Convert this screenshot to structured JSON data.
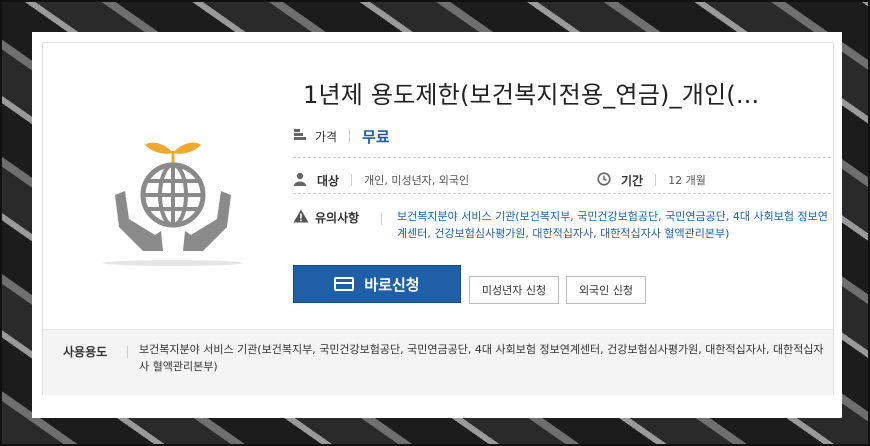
{
  "service": {
    "title": "1년제 용도제한(보건복지전용_연금)_개인(...",
    "price_label": "가격",
    "price_value": "무료",
    "target_label": "대상",
    "target_value": "개인, 미성년자, 외국인",
    "period_label": "기간",
    "period_value": "12 개월",
    "caution_label": "유의사항",
    "caution_text": "보건복지분야 서비스 기관(보건복지부, 국민건강보험공단, 국민연금공단, 4대 사회보험 정보연계센터, 건강보험심사평가원, 대한적십자사, 대한적십자사 혈액관리본부)"
  },
  "buttons": {
    "apply": "바로신청",
    "minor_apply": "미성년자 신청",
    "foreign_apply": "외국인 신청"
  },
  "usage": {
    "label": "사용용도",
    "text": "보건복지분야 서비스 기관(보건복지부, 국민건강보험공단, 국민연금공단, 4대 사회보험 정보연계센터, 건강보험심사평가원, 대한적십자사, 대한적십자사 혈액관리본부)"
  },
  "colors": {
    "accent": "#1f5fa8",
    "leaf": "#f0a92e",
    "icon_gray": "#8a8a8a"
  },
  "icons": {
    "logo": "globe-hands-icon",
    "price": "coins-icon",
    "target": "person-icon",
    "period": "clock-icon",
    "caution": "warning-icon",
    "button": "card-icon"
  }
}
